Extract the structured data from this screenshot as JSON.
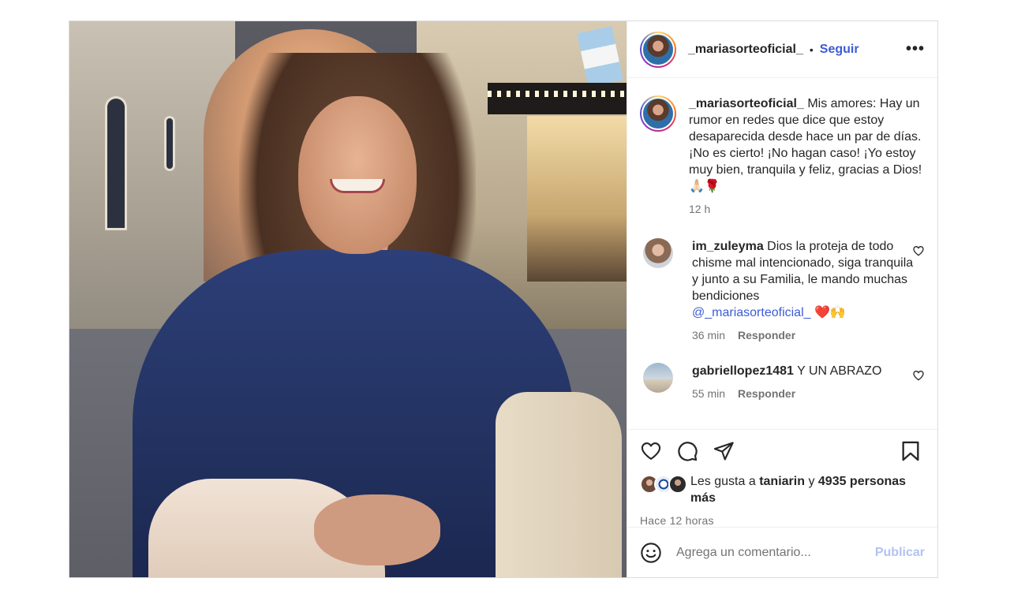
{
  "post": {
    "username": "_mariasorteoficial_",
    "separator": "•",
    "follow_label": "Seguir",
    "more_label": "•••",
    "avatar_icon": "profile-avatar",
    "photo_icon": "post-photo"
  },
  "caption": {
    "username": "_mariasorteoficial_",
    "text": "Mis amores: Hay un rumor en redes que dice que estoy desaparecida desde hace un par de días. ¡No es cierto! ¡No hagan caso! ¡Yo estoy muy bien, tranquila y feliz, gracias a Dios! 🙏🏻🌹",
    "time": "12 h"
  },
  "comments": [
    {
      "username": "im_zuleyma",
      "text": "Dios la proteja de todo chisme mal intencionado, siga tranquila y junto a su Familia, le mando muchas bendiciones",
      "mention": "@_mariasorteoficial_",
      "emoji": "❤️🙌",
      "time": "36 min",
      "reply_label": "Responder"
    },
    {
      "username": "gabriellopez1481",
      "text": "Y UN ABRAZO",
      "time": "55 min",
      "reply_label": "Responder"
    }
  ],
  "actions": {
    "like_icon": "heart-icon",
    "comment_icon": "comment-icon",
    "share_icon": "share-icon",
    "save_icon": "bookmark-icon"
  },
  "likes": {
    "prefix": "Les gusta a",
    "user": "taniarin",
    "conj": "y",
    "count_text": "4935 personas más"
  },
  "posted_time": "Hace 12 horas",
  "add_comment": {
    "placeholder": "Agrega un comentario...",
    "publish_label": "Publicar",
    "emoji_icon": "emoji-icon"
  },
  "colors": {
    "link_blue": "#3d5bd6",
    "publish_disabled": "#b2c3f2",
    "muted_text": "#737373"
  }
}
